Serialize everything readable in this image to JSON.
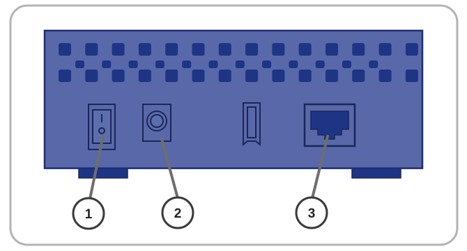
{
  "colors": {
    "frame": "#b3b3b3",
    "body": "#5868a9",
    "body_outline": "#1d2c74",
    "vent": "#1e3585",
    "port_outline": "#1b2658",
    "leader": "#6e6e6e",
    "callout_ring": "#3a3a3a"
  },
  "callouts": [
    {
      "label": "1"
    },
    {
      "label": "2"
    },
    {
      "label": "3"
    }
  ]
}
